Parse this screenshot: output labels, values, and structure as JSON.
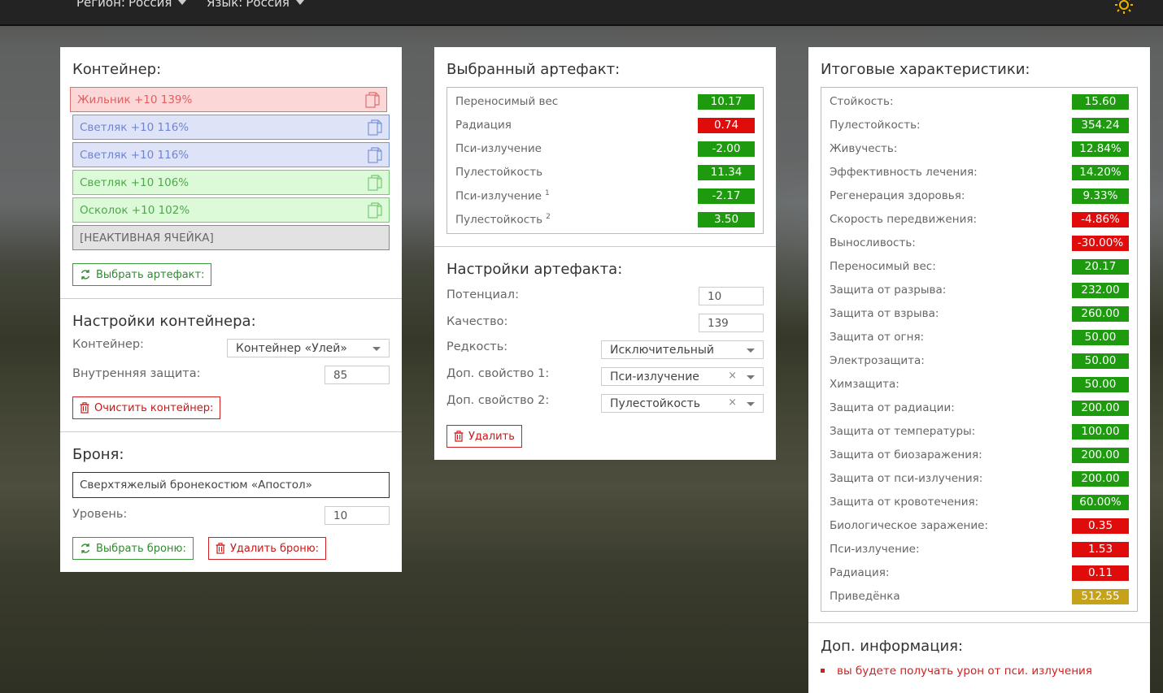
{
  "topbar": {
    "region_label": "Регион:",
    "region_value": "Россия",
    "language_label": "Язык:",
    "language_value": "Россия"
  },
  "container": {
    "title": "Контейнер:",
    "slots": [
      {
        "text": "Жильник +10 139%",
        "color": "red"
      },
      {
        "text": "Светляк +10 116%",
        "color": "blue"
      },
      {
        "text": "Светляк +10 116%",
        "color": "blue"
      },
      {
        "text": "Светляк +10 106%",
        "color": "green"
      },
      {
        "text": "Осколок +10 102%",
        "color": "green"
      },
      {
        "text": "[НЕАКТИВНАЯ ЯЧЕЙКА]",
        "color": "gray"
      }
    ],
    "select_artifact_button": "Выбрать артефакт:"
  },
  "container_settings": {
    "title": "Настройки контейнера:",
    "container_label": "Контейнер:",
    "container_value": "Контейнер «Улей»",
    "inner_protection_label": "Внутренняя защита:",
    "inner_protection_value": "85",
    "clear_button": "Очистить контейнер:"
  },
  "armor": {
    "title": "Броня:",
    "armor_value": "Сверхтяжелый бронекостюм «Апостол»",
    "level_label": "Уровень:",
    "level_value": "10",
    "select_button": "Выбрать броню:",
    "delete_button": "Удалить броню:"
  },
  "selected_artifact": {
    "title": "Выбранный артефакт:",
    "stats": [
      {
        "name": "Переносимый вес",
        "sup": "",
        "value": "10.17",
        "color": "green"
      },
      {
        "name": "Радиация",
        "sup": "",
        "value": "0.74",
        "color": "red"
      },
      {
        "name": "Пси-излучение",
        "sup": "",
        "value": "-2.00",
        "color": "green"
      },
      {
        "name": "Пулестойкость",
        "sup": "",
        "value": "11.34",
        "color": "green"
      },
      {
        "name": "Пси-излучение",
        "sup": "1",
        "value": "-2.17",
        "color": "green"
      },
      {
        "name": "Пулестойкость",
        "sup": "2",
        "value": "3.50",
        "color": "green"
      }
    ]
  },
  "artifact_settings": {
    "title": "Настройки артефакта:",
    "potential_label": "Потенциал:",
    "potential_value": "10",
    "quality_label": "Качество:",
    "quality_value": "139",
    "rarity_label": "Редкость:",
    "rarity_value": "Исключительный",
    "extra1_label": "Доп. свойство 1:",
    "extra1_value": "Пси-излучение",
    "extra2_label": "Доп. свойство 2:",
    "extra2_value": "Пулестойкость",
    "clear_symbol": "×",
    "delete_button": "Удалить"
  },
  "totals": {
    "title": "Итоговые характеристики:",
    "stats": [
      {
        "name": "Стойкость:",
        "value": "15.60",
        "color": "green"
      },
      {
        "name": "Пулестойкость:",
        "value": "354.24",
        "color": "green"
      },
      {
        "name": "Живучесть:",
        "value": "12.84%",
        "color": "green"
      },
      {
        "name": "Эффективность лечения:",
        "value": "14.20%",
        "color": "green"
      },
      {
        "name": "Регенерация здоровья:",
        "value": "9.33%",
        "color": "green"
      },
      {
        "name": "Скорость передвижения:",
        "value": "-4.86%",
        "color": "red"
      },
      {
        "name": "Выносливость:",
        "value": "-30.00%",
        "color": "red"
      },
      {
        "name": "Переносимый вес:",
        "value": "20.17",
        "color": "green"
      },
      {
        "name": "Защита от разрыва:",
        "value": "232.00",
        "color": "green"
      },
      {
        "name": "Защита от взрыва:",
        "value": "260.00",
        "color": "green"
      },
      {
        "name": "Защита от огня:",
        "value": "50.00",
        "color": "green"
      },
      {
        "name": "Электрозащита:",
        "value": "50.00",
        "color": "green"
      },
      {
        "name": "Химзащита:",
        "value": "50.00",
        "color": "green"
      },
      {
        "name": "Защита от радиации:",
        "value": "200.00",
        "color": "green"
      },
      {
        "name": "Защита от температуры:",
        "value": "100.00",
        "color": "green"
      },
      {
        "name": "Защита от биозаражения:",
        "value": "200.00",
        "color": "green"
      },
      {
        "name": "Защита от пси-излучения:",
        "value": "200.00",
        "color": "green"
      },
      {
        "name": "Защита от кровотечения:",
        "value": "60.00%",
        "color": "green"
      },
      {
        "name": "Биологическое заражение:",
        "value": "0.35",
        "color": "red"
      },
      {
        "name": "Пси-излучение:",
        "value": "1.53",
        "color": "red"
      },
      {
        "name": "Радиация:",
        "value": "0.11",
        "color": "red"
      },
      {
        "name": "Приведёнка",
        "value": "512.55",
        "color": "gold"
      }
    ]
  },
  "extra_info": {
    "title": "Доп. информация:",
    "items": [
      "вы будете получать урон от пси. излучения"
    ]
  },
  "colors": {
    "green": "#1e9a0f",
    "red": "#e00c0c",
    "gold": "#c6a21a"
  }
}
